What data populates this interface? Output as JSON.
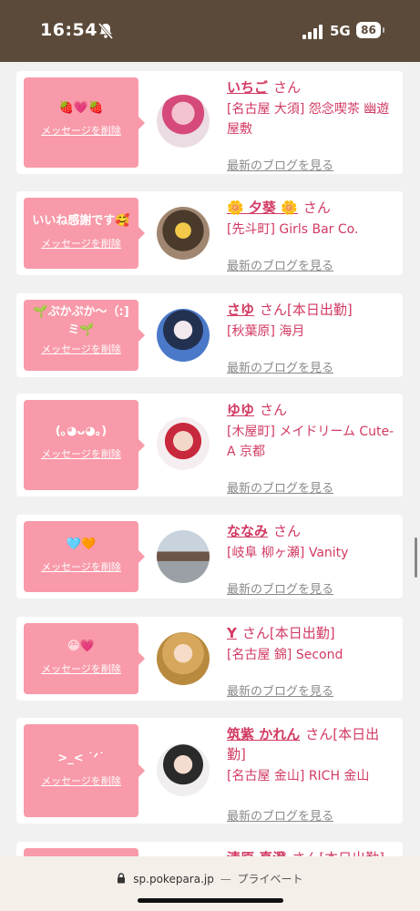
{
  "status_bar": {
    "time": "16:54",
    "network": "5G",
    "battery": "86"
  },
  "url_bar": {
    "lock_icon": "lock-icon",
    "domain": "sp.pokepara.jp",
    "separator": "—",
    "mode": "プライベート"
  },
  "delete_label": "メッセージを削除",
  "blog_label": "最新のブログを見る",
  "accent_color": "#f89aa9",
  "text_accent": "#d23a62",
  "cards": [
    {
      "message": "🍓💗🍓",
      "name": "いちご",
      "san": "さん",
      "shop": "[名古屋 大須] 怨念喫茶 幽遊屋敷"
    },
    {
      "message": "いいね感謝です🥰",
      "name": "🌼 夕葵 🌼",
      "san": "さん",
      "shop": "[先斗町] Girls Bar Co."
    },
    {
      "message": "🌱ぷかぷか〜（:]ミ🌱",
      "name": "さゆ",
      "san": "さん[本日出勤]",
      "shop": "[秋葉原] 海月"
    },
    {
      "message": "(｡◕ᴗ◕｡)",
      "name": "ゆゆ",
      "san": "さん",
      "shop": "[木屋町] メイドリーム Cute-A 京都"
    },
    {
      "message": "🩵🧡",
      "name": "ななみ",
      "san": "さん",
      "shop": "[岐阜 柳ヶ瀬] Vanity"
    },
    {
      "message": "😀💗",
      "name": "Y",
      "san": "さん[本日出勤]",
      "shop": "[名古屋 錦] Second"
    },
    {
      "message": ">_< ˙ᐟ˙",
      "name": "筑紫 かれん",
      "san": "さん[本日出勤]",
      "shop": "[名古屋 金山] RICH 金山"
    },
    {
      "message": "",
      "name": "清原 真澄",
      "san": "さん[本日出勤]",
      "shop": ""
    }
  ]
}
